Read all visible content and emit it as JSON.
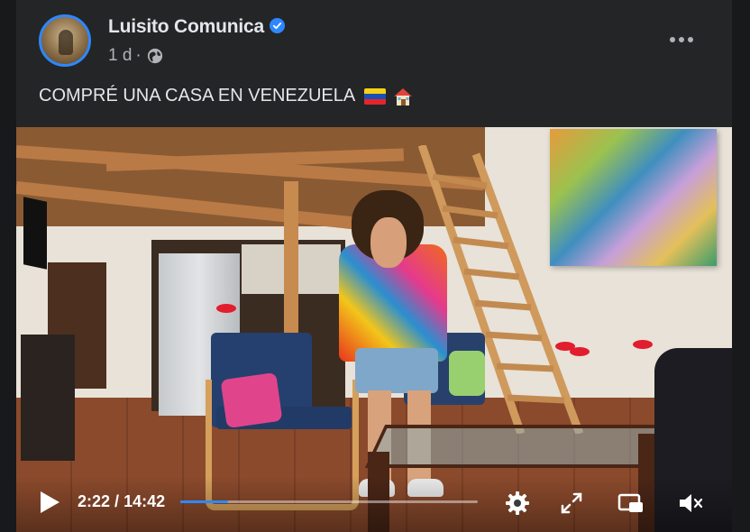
{
  "post": {
    "author": "Luisito Comunica",
    "time_ago": "1 d",
    "separator": "·",
    "text": "COMPRÉ UNA CASA EN VENEZUELA",
    "emojis": [
      "venezuela-flag-icon",
      "house-icon"
    ]
  },
  "video": {
    "current_time": "2:22",
    "time_divider": "/",
    "duration": "14:42",
    "progress_fraction": 0.161,
    "controls": [
      "play-icon",
      "settings-gear-icon",
      "fullscreen-expand-icon",
      "picture-in-picture-icon",
      "volume-muted-icon"
    ]
  },
  "colors": {
    "background": "#18191a",
    "card": "#242526",
    "primary_text": "#e4e6eb",
    "secondary_text": "#b0b3b8",
    "accent_blue": "#2d88ff"
  }
}
